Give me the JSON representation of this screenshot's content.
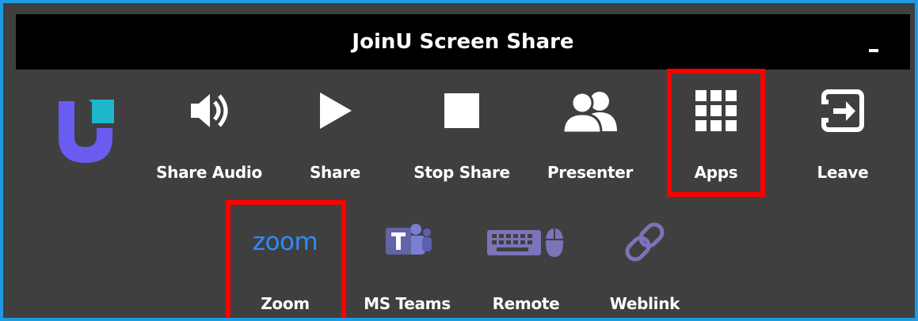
{
  "window": {
    "title": "JoinU Screen Share",
    "minimize_icon": "minimize-icon"
  },
  "colors": {
    "frame_border": "#1e9be0",
    "titlebar_bg": "#000000",
    "panel_bg": "#3f3f3f",
    "highlight": "#ff0000",
    "logo_purple": "#6a5cf0",
    "logo_teal": "#1db7c9",
    "zoom_blue": "#2d8cff",
    "teams_purple": "#6264a7",
    "icon_purple": "#7b74b8"
  },
  "toolbar": [
    {
      "label": "Share Audio",
      "icon": "speaker-icon"
    },
    {
      "label": "Share",
      "icon": "play-icon"
    },
    {
      "label": "Stop Share",
      "icon": "stop-icon"
    },
    {
      "label": "Presenter",
      "icon": "presenter-icon"
    },
    {
      "label": "Apps",
      "icon": "apps-grid-icon",
      "highlighted": true
    },
    {
      "label": "Leave",
      "icon": "leave-icon"
    }
  ],
  "apps": [
    {
      "label": "Zoom",
      "icon": "zoom-logo-icon",
      "logo_text": "zoom",
      "highlighted": true
    },
    {
      "label": "MS Teams",
      "icon": "ms-teams-icon"
    },
    {
      "label": "Remote",
      "icon": "keyboard-mouse-icon"
    },
    {
      "label": "Weblink",
      "icon": "link-icon"
    }
  ]
}
